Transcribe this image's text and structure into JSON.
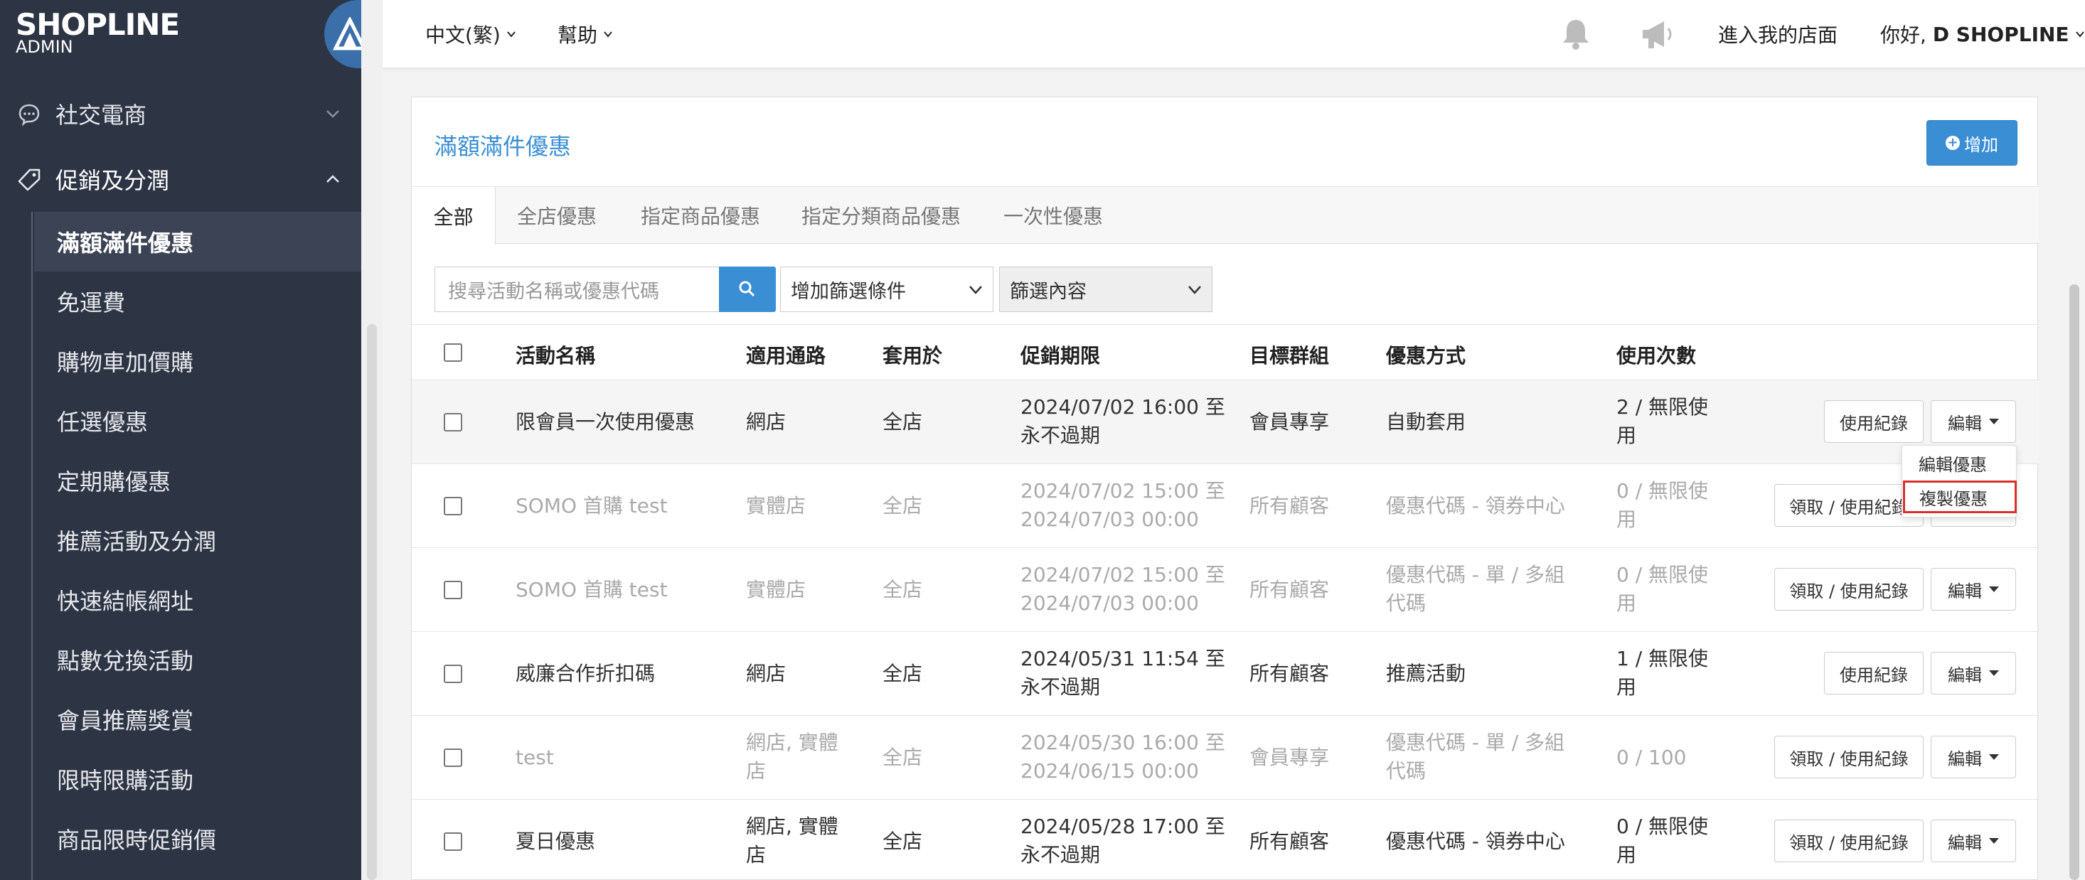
{
  "brand": {
    "name": "SHOPLINE",
    "sub": "ADMIN"
  },
  "sidebar": {
    "groups": [
      {
        "label": "社交電商",
        "icon": "chat-bubble-icon"
      },
      {
        "label": "促銷及分潤",
        "icon": "tag-icon"
      }
    ],
    "items": [
      {
        "label": "滿額滿件優惠"
      },
      {
        "label": "免運費"
      },
      {
        "label": "購物車加價購"
      },
      {
        "label": "任選優惠"
      },
      {
        "label": "定期購優惠"
      },
      {
        "label": "推薦活動及分潤"
      },
      {
        "label": "快速結帳網址"
      },
      {
        "label": "點數兌換活動"
      },
      {
        "label": "會員推薦獎賞"
      },
      {
        "label": "限時限購活動"
      },
      {
        "label": "商品限時促銷價"
      }
    ]
  },
  "topbar": {
    "language": "中文(繁)",
    "help": "幫助",
    "store_link": "進入我的店面",
    "greeting": "你好,",
    "user": "D SHOPLINE"
  },
  "card": {
    "title": "滿額滿件優惠",
    "add_button": "增加"
  },
  "tabs": [
    "全部",
    "全店優惠",
    "指定商品優惠",
    "指定分類商品優惠",
    "一次性優惠"
  ],
  "filters": {
    "search_placeholder": "搜尋活動名稱或優惠代碼",
    "add_filter": "增加篩選條件",
    "filter_content": "篩選內容"
  },
  "table": {
    "headers": [
      "活動名稱",
      "適用通路",
      "套用於",
      "促銷期限",
      "目標群組",
      "優惠方式",
      "使用次數"
    ],
    "rows": [
      {
        "name": "限會員一次使用優惠",
        "channel": "網店",
        "apply": "全店",
        "period1": "2024/07/02 16:00 至",
        "period2": "永不過期",
        "target": "會員專享",
        "method1": "自動套用",
        "method2": "",
        "usage1": "2 / 無限使",
        "usage2": "用",
        "records": "使用紀錄",
        "edit": "編輯"
      },
      {
        "name": "SOMO 首購 test",
        "channel": "實體店",
        "apply": "全店",
        "period1": "2024/07/02 15:00 至",
        "period2": "2024/07/03 00:00",
        "target": "所有顧客",
        "method1": "優惠代碼 - 領券中心",
        "method2": "",
        "usage1": "0 / 無限使",
        "usage2": "用",
        "records": "領取 / 使用紀錄",
        "edit": "編輯"
      },
      {
        "name": "SOMO 首購 test",
        "channel": "實體店",
        "apply": "全店",
        "period1": "2024/07/02 15:00 至",
        "period2": "2024/07/03 00:00",
        "target": "所有顧客",
        "method1": "優惠代碼 - 單 / 多組",
        "method2": "代碼",
        "usage1": "0 / 無限使",
        "usage2": "用",
        "records": "領取 / 使用紀錄",
        "edit": "編輯"
      },
      {
        "name": "威廉合作折扣碼",
        "channel": "網店",
        "apply": "全店",
        "period1": "2024/05/31 11:54 至",
        "period2": "永不過期",
        "target": "所有顧客",
        "method1": "推薦活動",
        "method2": "",
        "usage1": "1 / 無限使",
        "usage2": "用",
        "records": "使用紀錄",
        "edit": "編輯"
      },
      {
        "name": "test",
        "channel": "網店, 實體",
        "channel2": "店",
        "apply": "全店",
        "period1": "2024/05/30 16:00 至",
        "period2": "2024/06/15 00:00",
        "target": "會員專享",
        "method1": "優惠代碼 - 單 / 多組",
        "method2": "代碼",
        "usage1": "0 / 100",
        "usage2": "",
        "records": "領取 / 使用紀錄",
        "edit": "編輯"
      },
      {
        "name": "夏日優惠",
        "channel": "網店, 實體",
        "channel2": "店",
        "apply": "全店",
        "period1": "2024/05/28 17:00 至",
        "period2": "永不過期",
        "target": "所有顧客",
        "method1": "優惠代碼 - 領券中心",
        "method2": "",
        "usage1": "0 / 無限使",
        "usage2": "用",
        "records": "領取 / 使用紀錄",
        "edit": "編輯"
      }
    ]
  },
  "dropdown": {
    "edit": "編輯優惠",
    "copy": "複製優惠"
  }
}
